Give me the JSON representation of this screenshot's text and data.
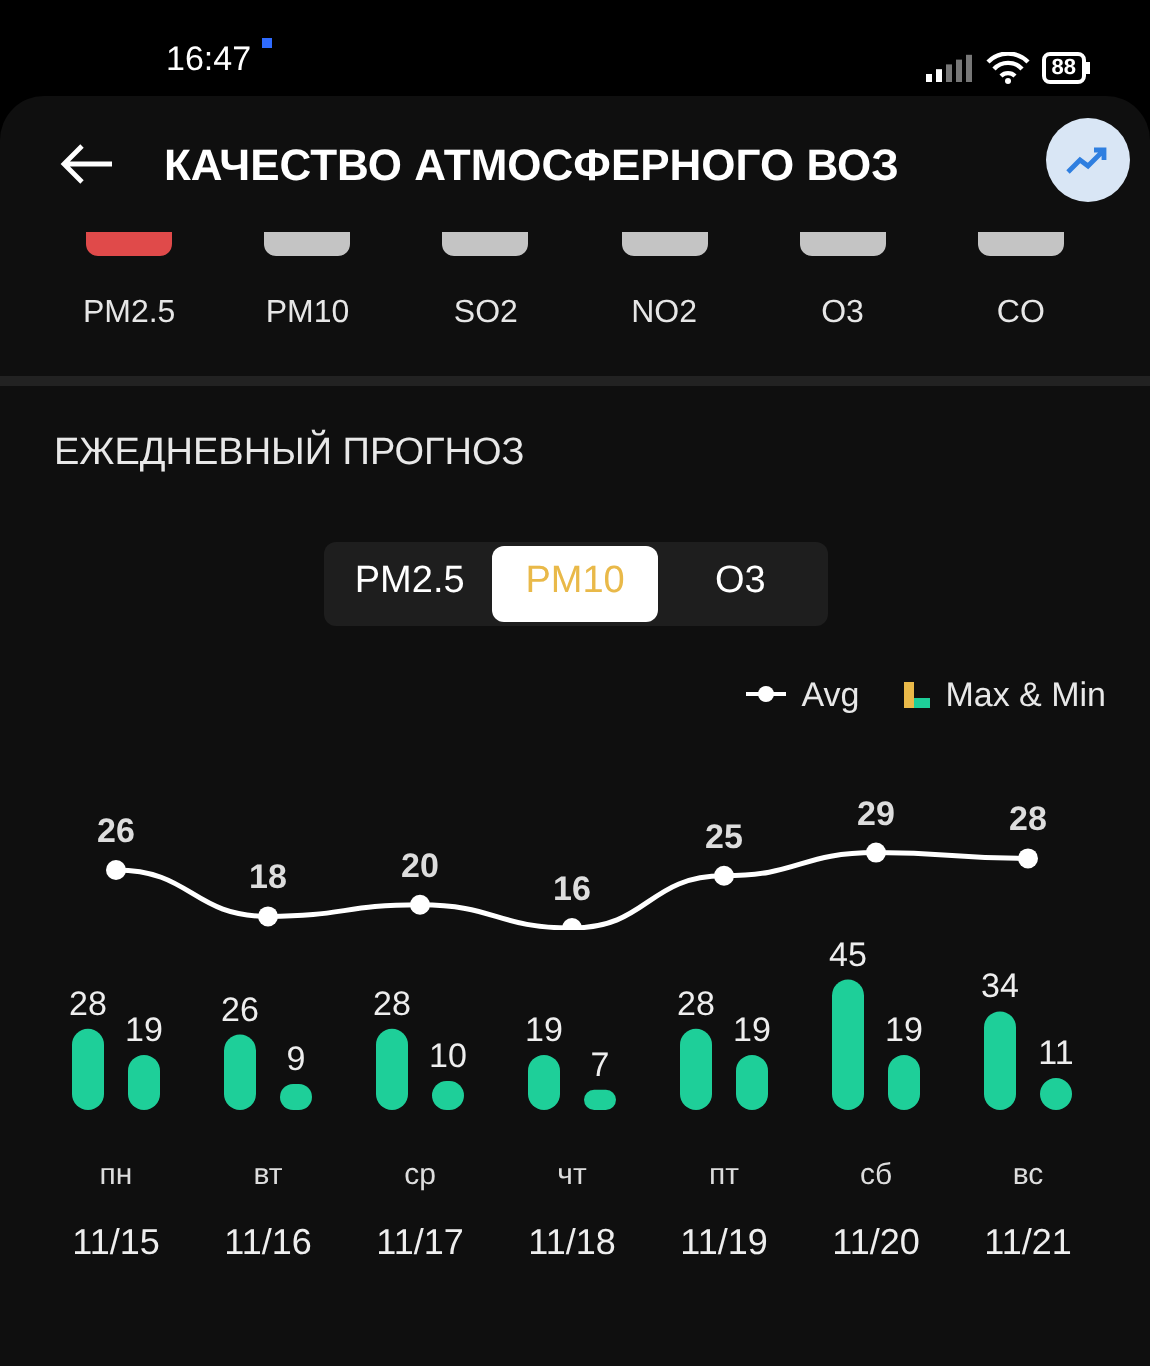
{
  "status_bar": {
    "time": "16:47",
    "battery": "88"
  },
  "header": {
    "title": "КАЧЕСТВО АТМОСФЕРНОГО ВОЗ"
  },
  "pollutants": [
    {
      "label": "PM2.5",
      "color": "#e04a4a"
    },
    {
      "label": "PM10",
      "color": "#c4c4c4"
    },
    {
      "label": "SO2",
      "color": "#c4c4c4"
    },
    {
      "label": "NO2",
      "color": "#c4c4c4"
    },
    {
      "label": "O3",
      "color": "#c4c4c4"
    },
    {
      "label": "CO",
      "color": "#c4c4c4"
    }
  ],
  "forecast": {
    "title": "ЕЖЕДНЕВНЫЙ ПРОГНОЗ",
    "tabs": [
      {
        "label": "PM2.5",
        "selected": false
      },
      {
        "label": "PM10",
        "selected": true
      },
      {
        "label": "O3",
        "selected": false
      }
    ],
    "bars_legend_label": "Max & Min",
    "avg_chart": {
      "chart_data": {
        "type": "line",
        "series": [
          {
            "name": "Avg",
            "color": "#ffffff",
            "marker": "circle",
            "values": [
              26,
              18,
              20,
              16,
              25,
              29,
              28
            ]
          }
        ],
        "data_labels": true
      }
    },
    "range_chart": {
      "chart_data": {
        "type": "bar",
        "categories": [
          "11/15",
          "11/16",
          "11/17",
          "11/18",
          "11/19",
          "11/20",
          "11/21"
        ],
        "series": [
          {
            "color": "#1ecf99",
            "values": [
              28,
              26,
              28,
              19,
              28,
              45,
              34
            ]
          },
          {
            "color": "#1ecf99",
            "values": [
              19,
              9,
              10,
              7,
              19,
              19,
              11
            ]
          }
        ],
        "data_labels": true
      }
    },
    "weekdays": [
      "пн",
      "вт",
      "ср",
      "чт",
      "пт",
      "сб",
      "вс"
    ]
  }
}
